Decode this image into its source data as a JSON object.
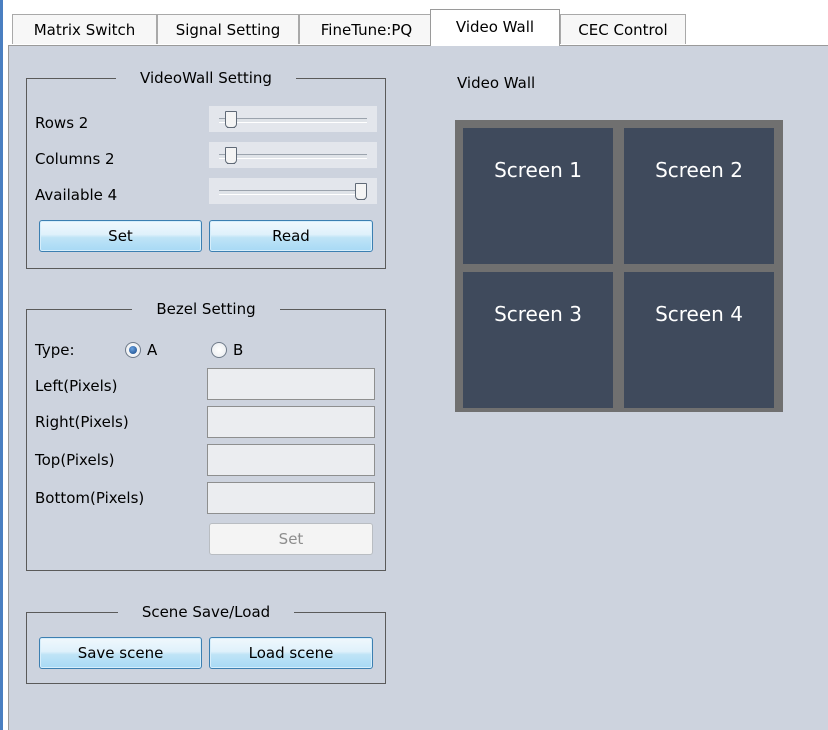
{
  "tabs": [
    {
      "label": "Matrix Switch",
      "active": false
    },
    {
      "label": "Signal Setting",
      "active": false
    },
    {
      "label": "FineTune:PQ",
      "active": false
    },
    {
      "label": "Video Wall",
      "active": true
    },
    {
      "label": "CEC Control",
      "active": false
    }
  ],
  "videowall_setting": {
    "title": "VideoWall Setting",
    "rows_label": "Rows 2",
    "columns_label": "Columns 2",
    "available_label": "Available 4",
    "set_label": "Set",
    "read_label": "Read"
  },
  "bezel_setting": {
    "title": "Bezel Setting",
    "type_label": "Type:",
    "option_a": "A",
    "option_b": "B",
    "selected": "A",
    "left_label": "Left(Pixels)",
    "right_label": "Right(Pixels)",
    "top_label": "Top(Pixels)",
    "bottom_label": "Bottom(Pixels)",
    "left_value": "",
    "right_value": "",
    "top_value": "",
    "bottom_value": "",
    "set_label": "Set"
  },
  "scene": {
    "title": "Scene Save/Load",
    "save_label": "Save scene",
    "load_label": "Load scene"
  },
  "video_wall": {
    "title": "Video Wall",
    "screens": [
      "Screen 1",
      "Screen 2",
      "Screen 3",
      "Screen 4"
    ]
  },
  "colors": {
    "panel_bg": "#cdd3de",
    "screen_bg": "#3f4a5c",
    "wall_frame": "#707070",
    "button_border": "#3c7fb1"
  }
}
